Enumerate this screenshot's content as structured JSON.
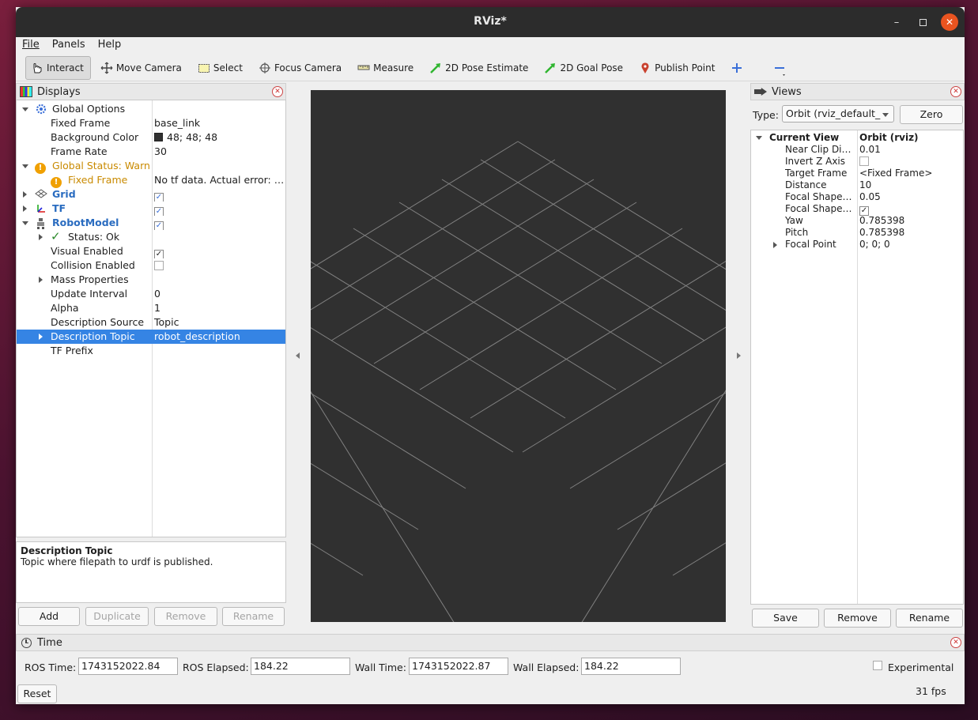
{
  "window": {
    "title": "RViz*"
  },
  "menu": [
    "File",
    "Panels",
    "Help"
  ],
  "toolbar": [
    {
      "label": "Interact",
      "icon": "hand-pointer-icon"
    },
    {
      "label": "Move Camera",
      "icon": "move-camera-icon"
    },
    {
      "label": "Select",
      "icon": "select-box-icon"
    },
    {
      "label": "Focus Camera",
      "icon": "focus-crosshair-icon"
    },
    {
      "label": "Measure",
      "icon": "ruler-icon"
    },
    {
      "label": "2D Pose Estimate",
      "icon": "green-arrow-icon"
    },
    {
      "label": "2D Goal Pose",
      "icon": "green-arrow-icon"
    },
    {
      "label": "Publish Point",
      "icon": "map-pin-icon"
    }
  ],
  "displays": {
    "title": "Displays",
    "rows": [
      {
        "label": "Global Options",
        "value": ""
      },
      {
        "label": "Fixed Frame",
        "value": "base_link"
      },
      {
        "label": "Background Color",
        "value": "48; 48; 48"
      },
      {
        "label": "Frame Rate",
        "value": "30"
      },
      {
        "label": "Global Status: Warn",
        "value": ""
      },
      {
        "label": "Fixed Frame",
        "value": "No tf data.  Actual error: …"
      },
      {
        "label": "Grid",
        "value": ""
      },
      {
        "label": "TF",
        "value": ""
      },
      {
        "label": "RobotModel",
        "value": ""
      },
      {
        "label": "Status: Ok",
        "value": ""
      },
      {
        "label": "Visual Enabled",
        "value": ""
      },
      {
        "label": "Collision Enabled",
        "value": ""
      },
      {
        "label": "Mass Properties",
        "value": ""
      },
      {
        "label": "Update Interval",
        "value": "0"
      },
      {
        "label": "Alpha",
        "value": "1"
      },
      {
        "label": "Description Source",
        "value": "Topic"
      },
      {
        "label": "Description Topic",
        "value": "robot_description"
      },
      {
        "label": "TF Prefix",
        "value": ""
      }
    ],
    "bg_swatch": "#303030",
    "help_title": "Description Topic",
    "help_text": "Topic where filepath to urdf is published.",
    "buttons": {
      "add": "Add",
      "duplicate": "Duplicate",
      "remove": "Remove",
      "rename": "Rename"
    }
  },
  "views": {
    "title": "Views",
    "type_label": "Type:",
    "type_value": "Orbit (rviz_default_",
    "zero": "Zero",
    "current_view": "Current View",
    "current_view_value": "Orbit (rviz)",
    "rows": [
      {
        "label": "Near Clip Di…",
        "value": "0.01"
      },
      {
        "label": "Invert Z Axis",
        "value": ""
      },
      {
        "label": "Target Frame",
        "value": "<Fixed Frame>"
      },
      {
        "label": "Distance",
        "value": "10"
      },
      {
        "label": "Focal Shape…",
        "value": "0.05"
      },
      {
        "label": "Focal Shape…",
        "value": ""
      },
      {
        "label": "Yaw",
        "value": "0.785398"
      },
      {
        "label": "Pitch",
        "value": "0.785398"
      },
      {
        "label": "Focal Point",
        "value": "0; 0; 0"
      }
    ],
    "buttons": {
      "save": "Save",
      "remove": "Remove",
      "rename": "Rename"
    }
  },
  "time": {
    "title": "Time",
    "ros_time_label": "ROS Time:",
    "ros_time": "1743152022.84",
    "ros_elapsed_label": "ROS Elapsed:",
    "ros_elapsed": "184.22",
    "wall_time_label": "Wall Time:",
    "wall_time": "1743152022.87",
    "wall_elapsed_label": "Wall Elapsed:",
    "wall_elapsed": "184.22",
    "experimental": "Experimental",
    "reset": "Reset",
    "fps": "31 fps"
  },
  "colors": {
    "accent": "#3584e4",
    "warn": "#c98a00",
    "link_blue": "#2a6cc0",
    "close": "#e95420"
  }
}
